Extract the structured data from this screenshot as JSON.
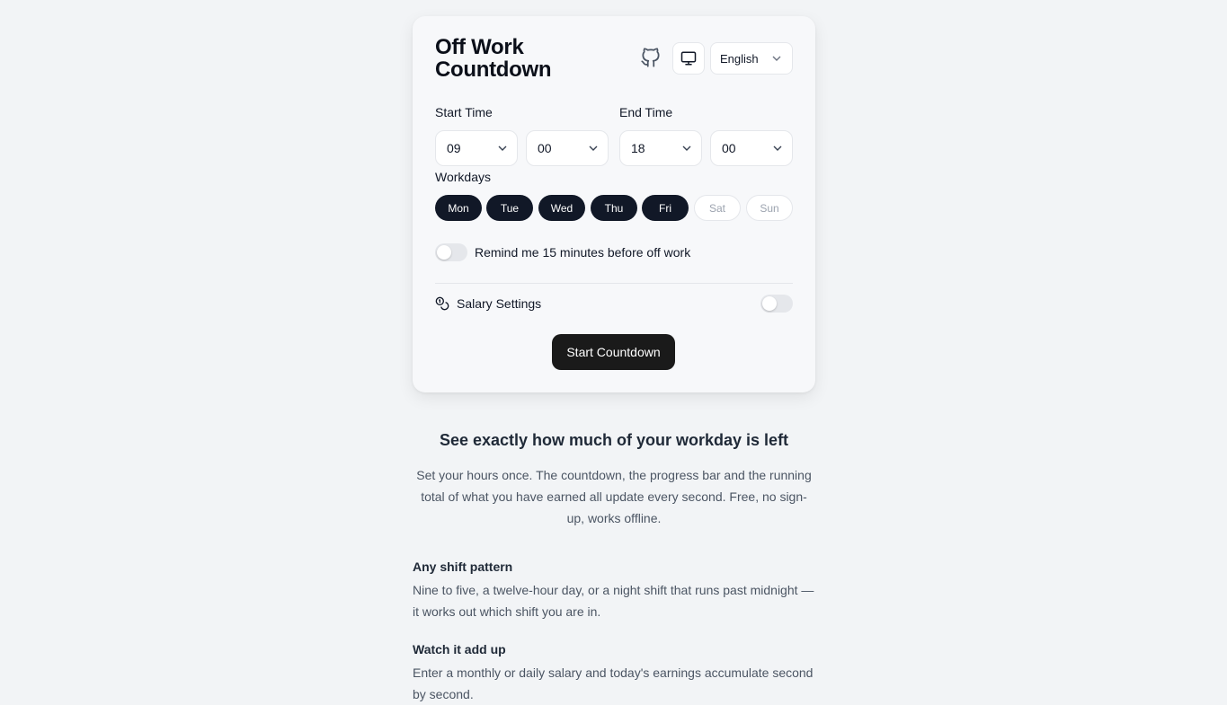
{
  "app": {
    "title": "Off Work Countdown"
  },
  "header": {
    "github_icon": "github-icon",
    "theme_icon": "monitor-icon",
    "language": "English"
  },
  "form": {
    "start_label": "Start Time",
    "end_label": "End Time",
    "start_hour": "09",
    "start_minute": "00",
    "end_hour": "18",
    "end_minute": "00",
    "workdays_label": "Workdays",
    "days": [
      {
        "label": "Mon",
        "active": true
      },
      {
        "label": "Tue",
        "active": true
      },
      {
        "label": "Wed",
        "active": true
      },
      {
        "label": "Thu",
        "active": true
      },
      {
        "label": "Fri",
        "active": true
      },
      {
        "label": "Sat",
        "active": false
      },
      {
        "label": "Sun",
        "active": false
      }
    ],
    "remind_label": "Remind me 15 minutes before off work",
    "remind_on": false,
    "salary_label": "Salary Settings",
    "salary_icon": "coins-icon",
    "salary_on": false,
    "start_button": "Start Countdown"
  },
  "content": {
    "headline": "See exactly how much of your workday is left",
    "intro": "Set your hours once. The countdown, the progress bar and the running total of what you have earned all update every second. Free, no sign-up, works offline.",
    "features": [
      {
        "title": "Any shift pattern",
        "desc": "Nine to five, a twelve-hour day, or a night shift that runs past midnight — it works out which shift you are in."
      },
      {
        "title": "Watch it add up",
        "desc": "Enter a monthly or daily salary and today's earnings accumulate second by second."
      }
    ]
  },
  "colors": {
    "accent": "#111827",
    "background": "#f2f4f6"
  }
}
